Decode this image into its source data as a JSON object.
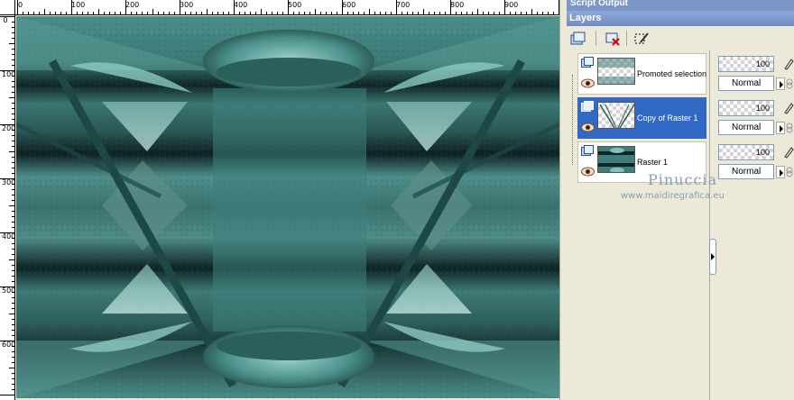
{
  "panels": {
    "script_output_title": "Script Output",
    "layers_title": "Layers"
  },
  "toolbar": {
    "new_layer_icon": "new-layer-icon",
    "delete_layer_icon": "delete-layer-icon",
    "edit_selection_icon": "edit-selection-icon"
  },
  "ruler": {
    "top_labels": [
      "0",
      "100",
      "200",
      "300",
      "400",
      "500",
      "600",
      "700",
      "800",
      "900"
    ],
    "left_labels": [
      "0",
      "100",
      "200",
      "300",
      "400",
      "500",
      "600"
    ]
  },
  "layers": [
    {
      "name": "Promoted selection",
      "opacity": "100",
      "blend_mode": "Normal",
      "selected": false
    },
    {
      "name": "Copy of Raster 1",
      "opacity": "100",
      "blend_mode": "Normal",
      "selected": true
    },
    {
      "name": "Raster 1",
      "opacity": "100",
      "blend_mode": "Normal",
      "selected": false
    }
  ],
  "watermark": {
    "name": "Pinuccia",
    "url": "www.maidiregrafica.eu"
  },
  "colors": {
    "selection": "#316ac5",
    "teal": "#3f7e7b",
    "panel_title": "#7b96c8"
  }
}
